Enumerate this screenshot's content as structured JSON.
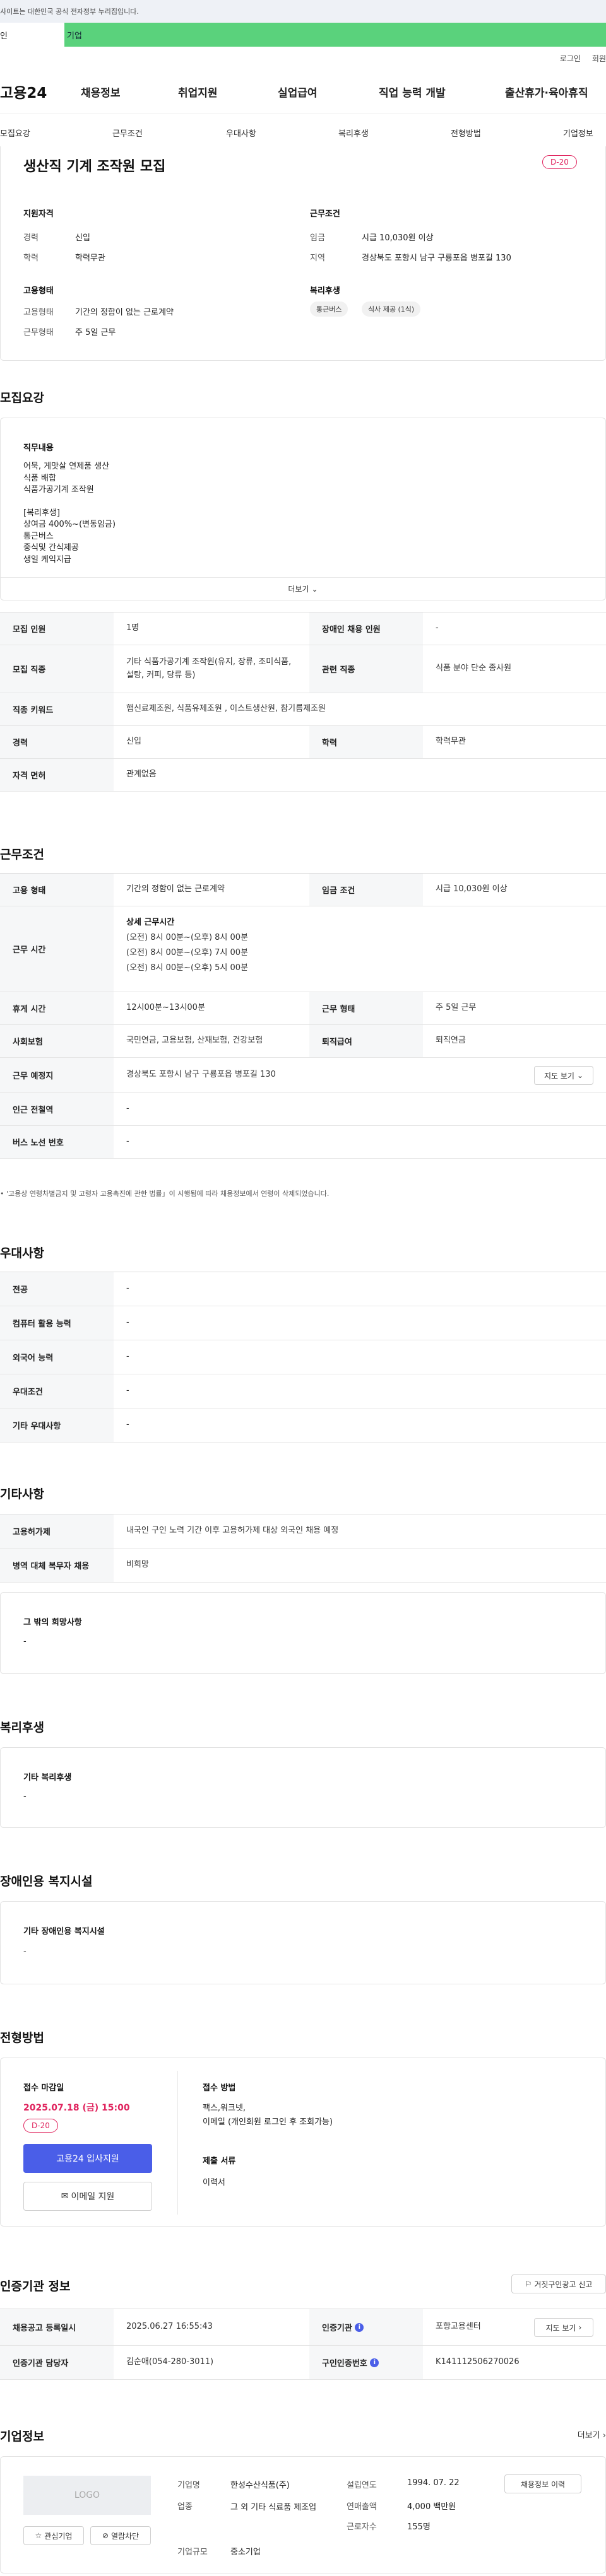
{
  "top": {
    "gov_notice": "사이트는 대한민국 공식 전자정부 누리집입니다.",
    "tab_person": "인",
    "tab_company": "기업",
    "login": "로그인",
    "signup": "회원",
    "logo": "고용24",
    "menu": [
      "채용정보",
      "취업지원",
      "실업급여",
      "직업 능력 개발",
      "출산휴가·육아휴직"
    ],
    "subnav": [
      "모집요강",
      "근무조건",
      "우대사항",
      "복리후생",
      "전형방법",
      "기업정보"
    ]
  },
  "header": {
    "title": "생산직 기계 조작원 모집",
    "dday": "D-20",
    "qual_title": "지원자격",
    "career_label": "경력",
    "career": "신입",
    "edu_label": "학력",
    "edu": "학력무관",
    "cond_title": "근무조건",
    "wage_label": "임금",
    "wage": "시급 10,030원 이상",
    "area_label": "지역",
    "area": "경상북도 포항시 남구 구룡포읍 병포길 130",
    "emp_title": "고용형태",
    "emptype_label": "고용형태",
    "emptype": "기간의 정함이 없는 근로계약",
    "worktype_label": "근무형태",
    "worktype": "주 5일 근무",
    "welfare_title": "복리후생",
    "chips": [
      "통근버스",
      "식사 제공 (1식)"
    ]
  },
  "recruit": {
    "title": "모집요강",
    "job_title": "직무내용",
    "job_lines": [
      "어묵, 게맛살 연제품 생산",
      "식품 배합",
      "식품가공기계 조작원",
      "",
      "[복리후생]",
      "상여금 400%~(변동임금)",
      "통근버스",
      "중식및 간식제공",
      "생일 케익지급"
    ],
    "more": "더보기",
    "rows": [
      {
        "h": "모집 인원",
        "v": "1명",
        "h2": "장애인 채용 인원",
        "v2": "-"
      },
      {
        "h": "모집 직종",
        "v": "기타 식품가공기계 조작원(유지, 장류, 조미식품, 설탕, 커피, 당류 등)",
        "h2": "관련 직종",
        "v2": "식품 분야 단순 종사원"
      },
      {
        "h": "직종 키워드",
        "v": "햄신료제조원, 식품유제조원 , 이스트생산원, 참기름제조원"
      },
      {
        "h": "경력",
        "v": "신입",
        "h2": "학력",
        "v2": "학력무관"
      },
      {
        "h": "자격 면허",
        "v": "관계없음"
      }
    ]
  },
  "work": {
    "title": "근무조건",
    "emptype_h": "고용 형태",
    "emptype": "기간의 정함이 없는 근로계약",
    "wage_h": "임금 조건",
    "wage": "시급 10,030원 이상",
    "hours_h": "근무 시간",
    "hours_title": "상세 근무시간",
    "hours": [
      "(오전) 8시 00분~(오후) 8시 00분",
      "(오전) 8시 00분~(오후) 7시 00분",
      "(오전) 8시 00분~(오후) 5시 00분"
    ],
    "break_h": "휴게 시간",
    "break": "12시00분~13시00분",
    "form_h": "근무 형태",
    "form": "주 5일 근무",
    "ins_h": "사회보험",
    "ins": "국민연금, 고용보험, 산재보험, 건강보험",
    "retire_h": "퇴직급여",
    "retire": "퇴직연금",
    "place_h": "근무 예정지",
    "place": "경상북도 포항시 남구 구룡포읍 병포길 130",
    "map_btn": "지도 보기",
    "station_h": "인근 전철역",
    "station": "-",
    "bus_h": "버스 노선 번호",
    "bus": "-",
    "note": "'고용상 연령차별금지 및 고령자 고용촉진에 관한 법률」이 시행됨에 따라 채용정보에서 연령이 삭제되었습니다."
  },
  "pref": {
    "title": "우대사항",
    "rows": [
      {
        "h": "전공",
        "v": "-"
      },
      {
        "h": "컴퓨터 활용 능력",
        "v": "-"
      },
      {
        "h": "외국어 능력",
        "v": "-"
      },
      {
        "h": "우대조건",
        "v": "-"
      },
      {
        "h": "기타 우대사항",
        "v": "-"
      }
    ]
  },
  "etc": {
    "title": "기타사항",
    "rows": [
      {
        "h": "고용허가제",
        "v": "내국인 구인 노력 기간 이후 고용허가제 대상 외국인 채용 예정"
      },
      {
        "h": "병역 대체 복무자 채용",
        "v": "비희망"
      }
    ],
    "box_title": "그 밖의 희망사항",
    "box_val": "-"
  },
  "welfare": {
    "title": "복리후생",
    "box_title": "기타 복리후생",
    "box_val": "-"
  },
  "disab": {
    "title": "장애인용 복지시설",
    "box_title": "기타 장애인용 복지시설",
    "box_val": "-"
  },
  "apply": {
    "title": "전형방법",
    "deadline_label": "접수 마감일",
    "deadline": "2025.07.18 (금) 15:00",
    "dday": "D-20",
    "apply_btn": "고용24 입사지원",
    "email_btn": "이메일 지원",
    "method_label": "접수 방법",
    "method": "팩스,워크넷,",
    "method2": "이메일 (개인회원 로그인 후 조회가능)",
    "docs_label": "제출 서류",
    "docs": "이력서"
  },
  "cert": {
    "title": "인증기관 정보",
    "report_btn": "거짓구인광고 신고",
    "reg_h": "채용공고 등록일시",
    "reg": "2025.06.27 16:55:43",
    "agency_h": "인증기관",
    "agency": "포항고용센터",
    "map_btn": "지도 보기",
    "manager_h": "인증기관 담당자",
    "manager": "김순애(054-280-3011)",
    "id_h": "구인인증번호",
    "id": "K141112506270026"
  },
  "company": {
    "title": "기업정보",
    "more": "더보기",
    "logo": "LOGO",
    "fav_btn": "관심기업",
    "block_btn": "열람차단",
    "name_h": "기업명",
    "name": "한성수산식품(주)",
    "type_h": "업종",
    "type": "그 외 기타 식료품 제조업",
    "scale_h": "기업규모",
    "scale": "중소기업",
    "year_h": "설립연도",
    "year": "1994. 07. 22",
    "sales_h": "연매출액",
    "sales": "4,000 백만원",
    "staff_h": "근로자수",
    "staff": "155명",
    "jobs_btn": "채용정보 이력"
  }
}
